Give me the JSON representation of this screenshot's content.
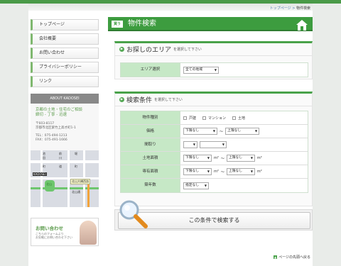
{
  "breadcrumb": {
    "home": "トップページ",
    "sep": ">",
    "current": "物件検索"
  },
  "sidebar": {
    "items": [
      {
        "label": "トップページ"
      },
      {
        "label": "会社概要"
      },
      {
        "label": "お問い合わせ"
      },
      {
        "label": "プライバシーポリシー"
      },
      {
        "label": "リンク"
      }
    ],
    "about": {
      "heading": "ABOUT KADOSEI",
      "name_line1": "京都の土地・住宅のご相談",
      "name_line2": "娘切 - 丁寧 - 迅速",
      "postal": "〒603-8117",
      "address": "京都市北区紫竹上高才町1-1",
      "tel": "TEL：075-494-1213",
      "fax": "FAX：075-491-1666"
    },
    "map": {
      "labels": [
        "池",
        "田",
        "町",
        "前",
        "川",
        "道",
        "堀",
        "町",
        "KADOSEI",
        "北山",
        "北山大橋西詰",
        "北山通"
      ]
    },
    "contact": {
      "title": "お問い合わせ",
      "sub1": "こちらのフォームより",
      "sub2": "お気軽にお問い合わせ下さい"
    }
  },
  "header": {
    "badge": "買う",
    "title": "物件検索"
  },
  "area_section": {
    "title": "お探しのエリア",
    "subtitle": "を選択して下さい",
    "row_label": "エリア選択",
    "select_value": "全ての地域"
  },
  "conditions": {
    "title": "検索条件",
    "subtitle": "を選択して下さい",
    "type_label": "物件種別",
    "type_options": [
      "戸建",
      "マンション",
      "土地"
    ],
    "price_label": "価格",
    "price_from": "下限なし",
    "price_to": "上限なし",
    "tilde": "～",
    "layout_label": "間取り",
    "layout_from": "",
    "layout_to": "",
    "land_label": "土地面積",
    "land_from": "下限なし",
    "land_to": "上限なし",
    "floor_label": "専有面積",
    "floor_from": "下限なし",
    "floor_to": "上限なし",
    "unit_m2": "m²",
    "age_label": "築年数",
    "age_value": "指定なし"
  },
  "search_button": {
    "label": "この条件で検索する"
  },
  "pagetop": {
    "label": "ページの先頭へ戻る"
  },
  "colors": {
    "accent": "#3d9c3f",
    "label_bg": "#c6e8c6"
  }
}
